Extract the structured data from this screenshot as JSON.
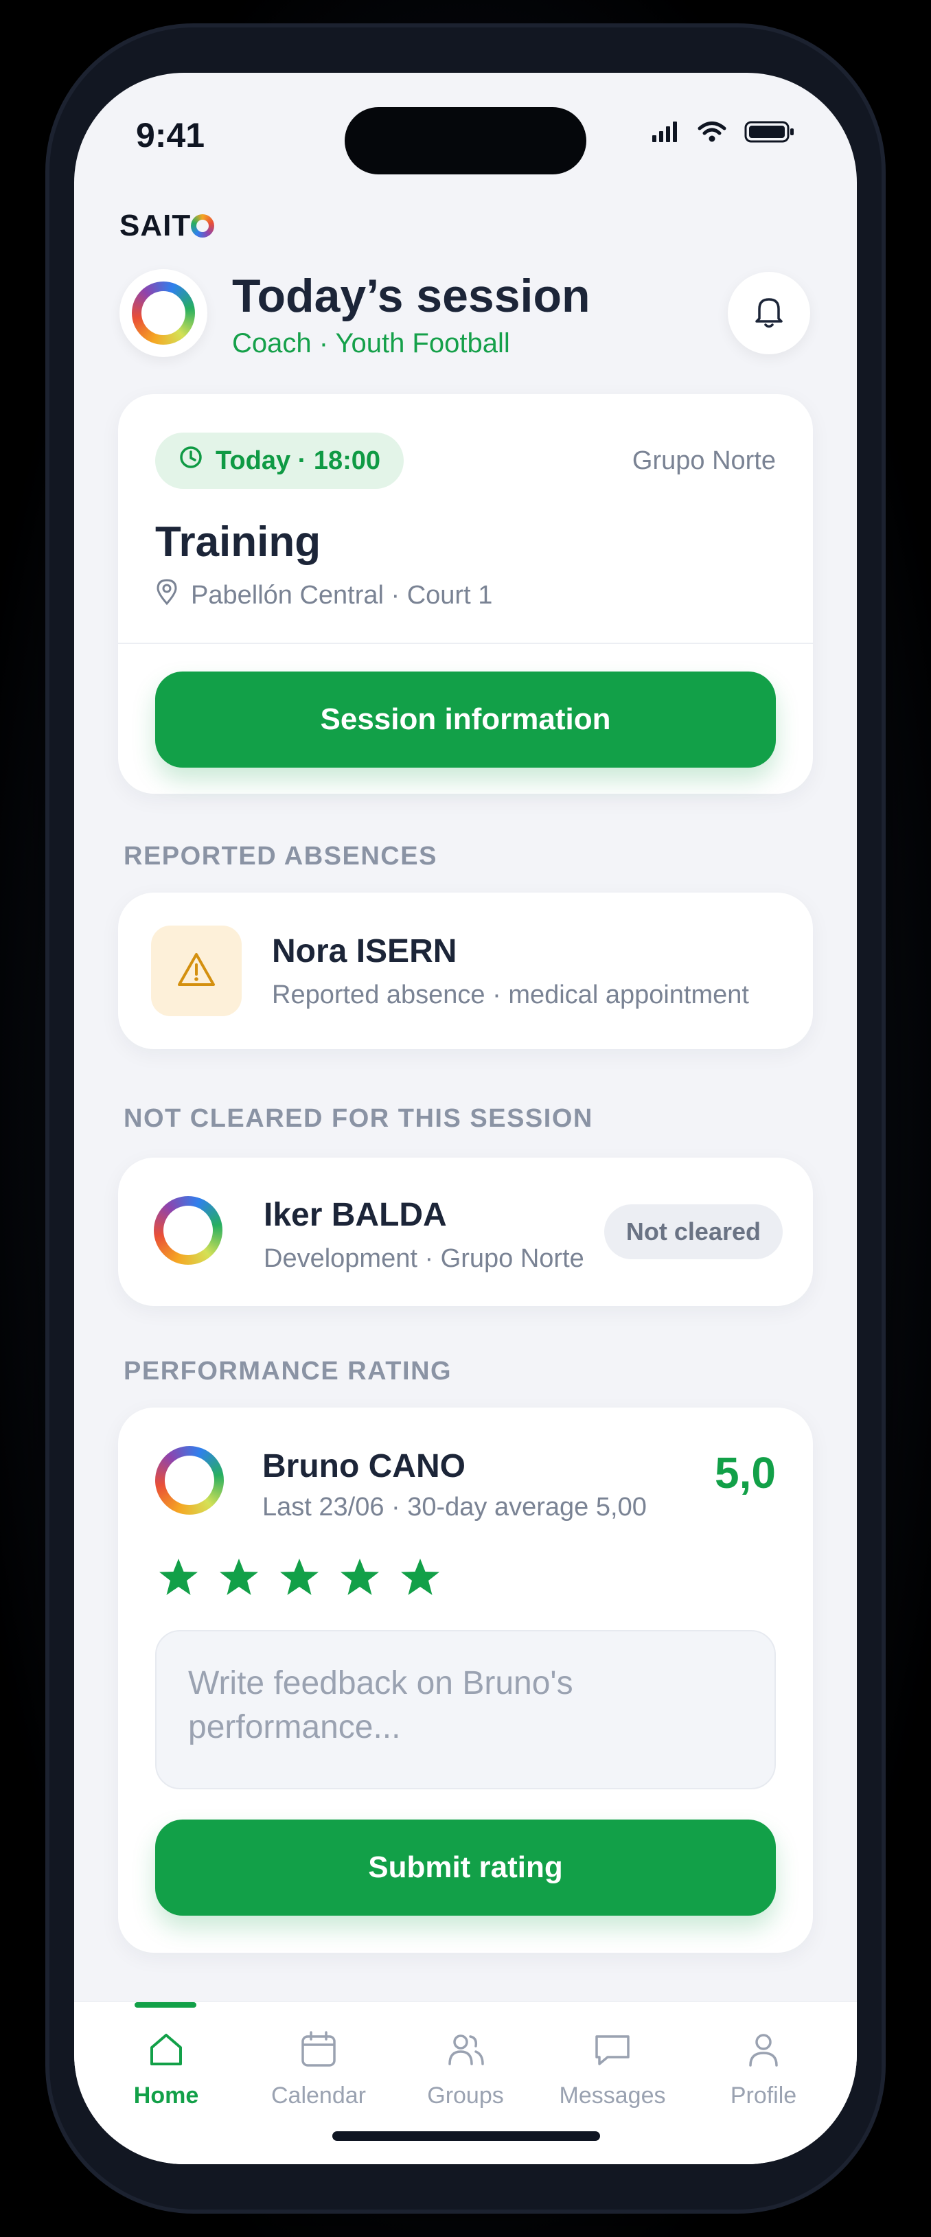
{
  "status_bar": {
    "time": "9:41"
  },
  "brand": {
    "name_prefix": "SAIT"
  },
  "header": {
    "title": "Today’s session",
    "subtitle": "Coach · Youth Football"
  },
  "session": {
    "time_pill": "Today · 18:00",
    "group": "Grupo Norte",
    "title": "Training",
    "location": "Pabellón Central · Court 1",
    "button_label": "Session information"
  },
  "absences": {
    "section_label": "REPORTED ABSENCES",
    "items": [
      {
        "name": "Nora ISERN",
        "detail": "Reported absence · medical appointment"
      }
    ]
  },
  "not_cleared": {
    "section_label": "NOT CLEARED FOR THIS SESSION",
    "items": [
      {
        "name": "Iker BALDA",
        "detail": "Development · Grupo Norte",
        "badge": "Not cleared"
      }
    ]
  },
  "rating": {
    "section_label": "PERFORMANCE RATING",
    "player_name": "Bruno CANO",
    "detail": "Last 23/06 · 30-day average 5,00",
    "score": "5,0",
    "stars_filled": 5,
    "stars_total": 5,
    "feedback_placeholder": "Write feedback on Bruno's performance...",
    "submit_label": "Submit rating"
  },
  "tabbar": {
    "tabs": [
      {
        "label": "Home",
        "icon": "home-icon",
        "active": true
      },
      {
        "label": "Calendar",
        "icon": "calendar-icon",
        "active": false
      },
      {
        "label": "Groups",
        "icon": "groups-icon",
        "active": false
      },
      {
        "label": "Messages",
        "icon": "messages-icon",
        "active": false
      },
      {
        "label": "Profile",
        "icon": "profile-icon",
        "active": false
      }
    ]
  },
  "colors": {
    "accent": "#12a048",
    "warning": "#d4900f",
    "background": "#f3f4f8"
  }
}
